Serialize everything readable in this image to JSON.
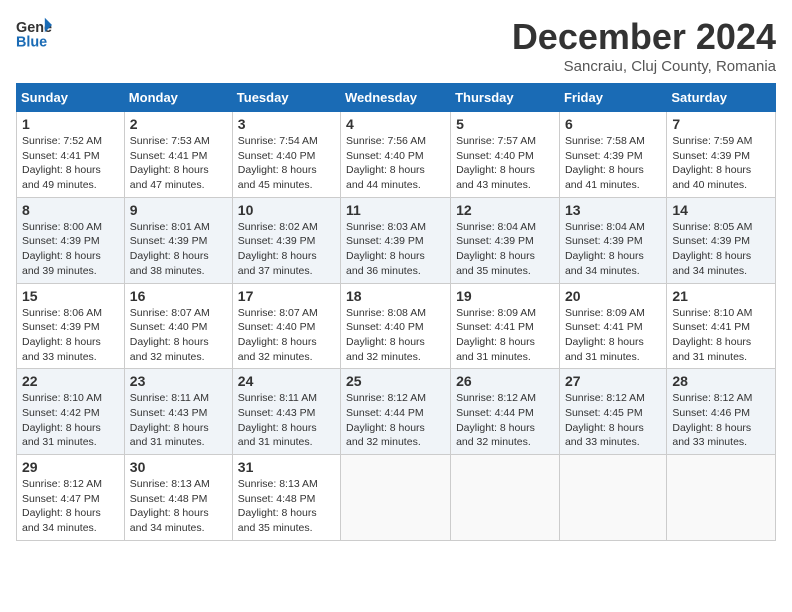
{
  "header": {
    "logo_line1": "General",
    "logo_line2": "Blue",
    "month_title": "December 2024",
    "location": "Sancraiu, Cluj County, Romania"
  },
  "weekdays": [
    "Sunday",
    "Monday",
    "Tuesday",
    "Wednesday",
    "Thursday",
    "Friday",
    "Saturday"
  ],
  "weeks": [
    [
      {
        "day": "1",
        "sunrise": "7:52 AM",
        "sunset": "4:41 PM",
        "daylight": "8 hours and 49 minutes."
      },
      {
        "day": "2",
        "sunrise": "7:53 AM",
        "sunset": "4:41 PM",
        "daylight": "8 hours and 47 minutes."
      },
      {
        "day": "3",
        "sunrise": "7:54 AM",
        "sunset": "4:40 PM",
        "daylight": "8 hours and 45 minutes."
      },
      {
        "day": "4",
        "sunrise": "7:56 AM",
        "sunset": "4:40 PM",
        "daylight": "8 hours and 44 minutes."
      },
      {
        "day": "5",
        "sunrise": "7:57 AM",
        "sunset": "4:40 PM",
        "daylight": "8 hours and 43 minutes."
      },
      {
        "day": "6",
        "sunrise": "7:58 AM",
        "sunset": "4:39 PM",
        "daylight": "8 hours and 41 minutes."
      },
      {
        "day": "7",
        "sunrise": "7:59 AM",
        "sunset": "4:39 PM",
        "daylight": "8 hours and 40 minutes."
      }
    ],
    [
      {
        "day": "8",
        "sunrise": "8:00 AM",
        "sunset": "4:39 PM",
        "daylight": "8 hours and 39 minutes."
      },
      {
        "day": "9",
        "sunrise": "8:01 AM",
        "sunset": "4:39 PM",
        "daylight": "8 hours and 38 minutes."
      },
      {
        "day": "10",
        "sunrise": "8:02 AM",
        "sunset": "4:39 PM",
        "daylight": "8 hours and 37 minutes."
      },
      {
        "day": "11",
        "sunrise": "8:03 AM",
        "sunset": "4:39 PM",
        "daylight": "8 hours and 36 minutes."
      },
      {
        "day": "12",
        "sunrise": "8:04 AM",
        "sunset": "4:39 PM",
        "daylight": "8 hours and 35 minutes."
      },
      {
        "day": "13",
        "sunrise": "8:04 AM",
        "sunset": "4:39 PM",
        "daylight": "8 hours and 34 minutes."
      },
      {
        "day": "14",
        "sunrise": "8:05 AM",
        "sunset": "4:39 PM",
        "daylight": "8 hours and 34 minutes."
      }
    ],
    [
      {
        "day": "15",
        "sunrise": "8:06 AM",
        "sunset": "4:39 PM",
        "daylight": "8 hours and 33 minutes."
      },
      {
        "day": "16",
        "sunrise": "8:07 AM",
        "sunset": "4:40 PM",
        "daylight": "8 hours and 32 minutes."
      },
      {
        "day": "17",
        "sunrise": "8:07 AM",
        "sunset": "4:40 PM",
        "daylight": "8 hours and 32 minutes."
      },
      {
        "day": "18",
        "sunrise": "8:08 AM",
        "sunset": "4:40 PM",
        "daylight": "8 hours and 32 minutes."
      },
      {
        "day": "19",
        "sunrise": "8:09 AM",
        "sunset": "4:41 PM",
        "daylight": "8 hours and 31 minutes."
      },
      {
        "day": "20",
        "sunrise": "8:09 AM",
        "sunset": "4:41 PM",
        "daylight": "8 hours and 31 minutes."
      },
      {
        "day": "21",
        "sunrise": "8:10 AM",
        "sunset": "4:41 PM",
        "daylight": "8 hours and 31 minutes."
      }
    ],
    [
      {
        "day": "22",
        "sunrise": "8:10 AM",
        "sunset": "4:42 PM",
        "daylight": "8 hours and 31 minutes."
      },
      {
        "day": "23",
        "sunrise": "8:11 AM",
        "sunset": "4:43 PM",
        "daylight": "8 hours and 31 minutes."
      },
      {
        "day": "24",
        "sunrise": "8:11 AM",
        "sunset": "4:43 PM",
        "daylight": "8 hours and 31 minutes."
      },
      {
        "day": "25",
        "sunrise": "8:12 AM",
        "sunset": "4:44 PM",
        "daylight": "8 hours and 32 minutes."
      },
      {
        "day": "26",
        "sunrise": "8:12 AM",
        "sunset": "4:44 PM",
        "daylight": "8 hours and 32 minutes."
      },
      {
        "day": "27",
        "sunrise": "8:12 AM",
        "sunset": "4:45 PM",
        "daylight": "8 hours and 33 minutes."
      },
      {
        "day": "28",
        "sunrise": "8:12 AM",
        "sunset": "4:46 PM",
        "daylight": "8 hours and 33 minutes."
      }
    ],
    [
      {
        "day": "29",
        "sunrise": "8:12 AM",
        "sunset": "4:47 PM",
        "daylight": "8 hours and 34 minutes."
      },
      {
        "day": "30",
        "sunrise": "8:13 AM",
        "sunset": "4:48 PM",
        "daylight": "8 hours and 34 minutes."
      },
      {
        "day": "31",
        "sunrise": "8:13 AM",
        "sunset": "4:48 PM",
        "daylight": "8 hours and 35 minutes."
      },
      null,
      null,
      null,
      null
    ]
  ]
}
